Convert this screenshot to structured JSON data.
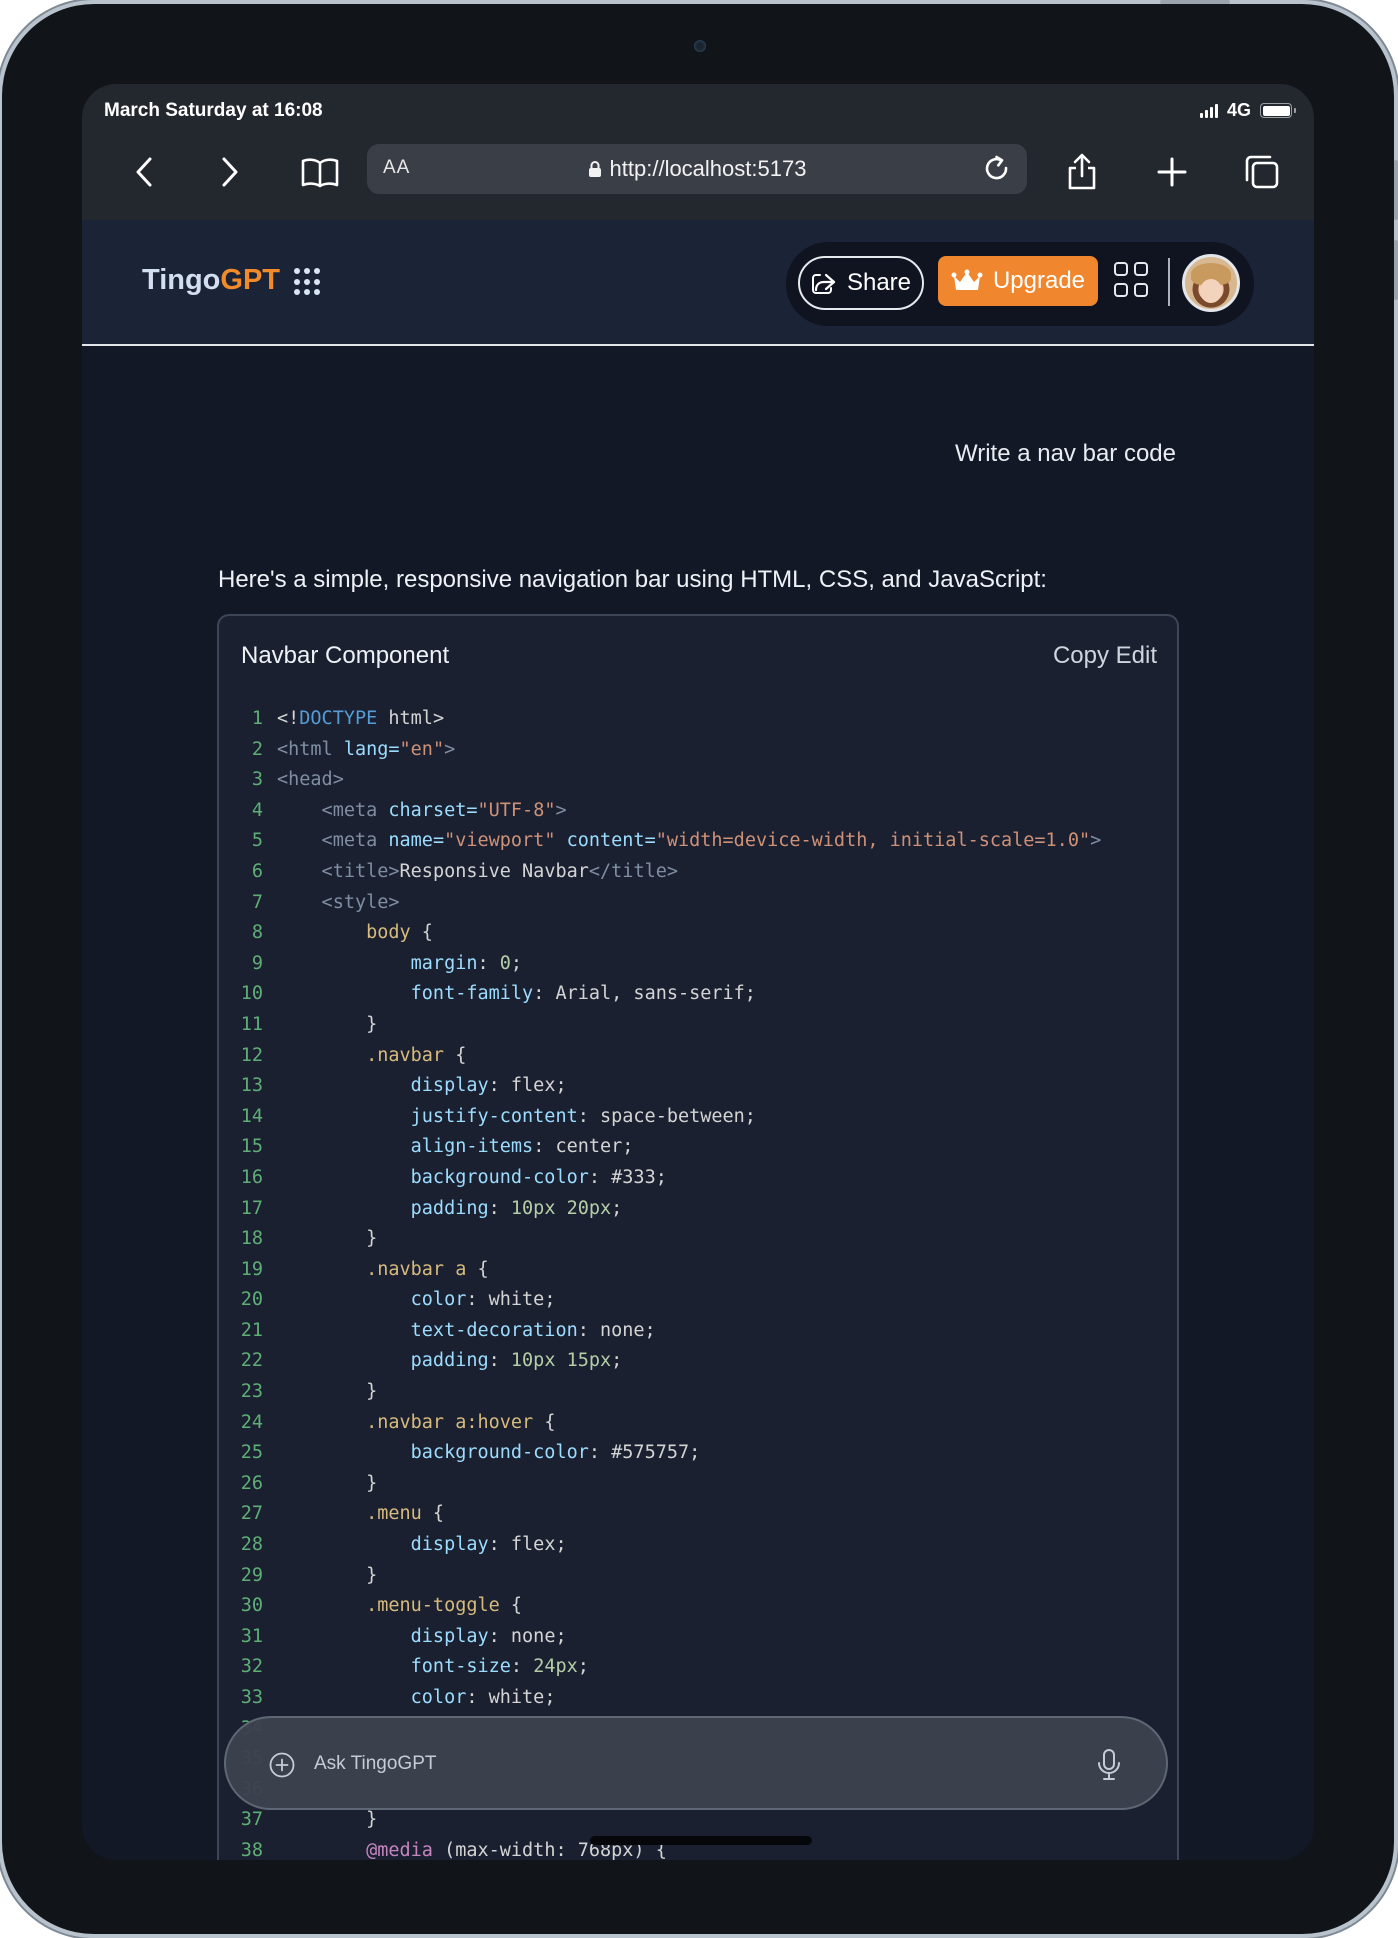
{
  "status_bar": {
    "time": "March Saturday at 16:08",
    "network": "4G"
  },
  "browser": {
    "url": "http://localhost:5173",
    "text_size_label": "AA"
  },
  "header": {
    "logo_part1": "Tingo",
    "logo_part2": "GPT",
    "share_label": "Share",
    "upgrade_label": "Upgrade",
    "colors": {
      "accent": "#f0862d",
      "header_bg": "#1b2336",
      "page_bg": "#121826"
    }
  },
  "chat": {
    "user_message": "Write a nav bar code",
    "assistant_intro": "Here's a simple, responsive navigation bar using HTML, CSS, and JavaScript:",
    "code_card": {
      "title": "Navbar Component",
      "actions": "Copy Edit",
      "lines": [
        [
          {
            "t": "<!",
            "c": "#d4d4d4"
          },
          {
            "t": "DOCTYPE",
            "c": "#569cd6"
          },
          {
            "t": " html>",
            "c": "#d4d4d4"
          }
        ],
        [
          {
            "t": "<html",
            "c": "#7f8ea3"
          },
          {
            "t": " lang=",
            "c": "#9cdcfe"
          },
          {
            "t": "\"en\"",
            "c": "#ce9178"
          },
          {
            "t": ">",
            "c": "#7f8ea3"
          }
        ],
        [
          {
            "t": "<head>",
            "c": "#7f8ea3"
          }
        ],
        [
          {
            "t": "    <meta",
            "c": "#7f8ea3"
          },
          {
            "t": " charset=",
            "c": "#9cdcfe"
          },
          {
            "t": "\"UTF-8\"",
            "c": "#ce9178"
          },
          {
            "t": ">",
            "c": "#7f8ea3"
          }
        ],
        [
          {
            "t": "    <meta",
            "c": "#7f8ea3"
          },
          {
            "t": " name=",
            "c": "#9cdcfe"
          },
          {
            "t": "\"viewport\"",
            "c": "#ce9178"
          },
          {
            "t": " content=",
            "c": "#9cdcfe"
          },
          {
            "t": "\"width=device-width, initial-scale=1.0\"",
            "c": "#ce9178"
          },
          {
            "t": ">",
            "c": "#7f8ea3"
          }
        ],
        [
          {
            "t": "    <title>",
            "c": "#7f8ea3"
          },
          {
            "t": "Responsive Navbar",
            "c": "#d4d4d4"
          },
          {
            "t": "</title>",
            "c": "#7f8ea3"
          }
        ],
        [
          {
            "t": "    <style>",
            "c": "#7f8ea3"
          }
        ],
        [
          {
            "t": "        body",
            "c": "#d7ba7d"
          },
          {
            "t": " {",
            "c": "#d4d4d4"
          }
        ],
        [
          {
            "t": "            margin",
            "c": "#9cdcfe"
          },
          {
            "t": ": ",
            "c": "#d4d4d4"
          },
          {
            "t": "0",
            "c": "#b5cea8"
          },
          {
            "t": ";",
            "c": "#d4d4d4"
          }
        ],
        [
          {
            "t": "            font-family",
            "c": "#9cdcfe"
          },
          {
            "t": ": Arial, sans-serif;",
            "c": "#d4d4d4"
          }
        ],
        [
          {
            "t": "        }",
            "c": "#d4d4d4"
          }
        ],
        [
          {
            "t": "        .navbar",
            "c": "#d7ba7d"
          },
          {
            "t": " {",
            "c": "#d4d4d4"
          }
        ],
        [
          {
            "t": "            display",
            "c": "#9cdcfe"
          },
          {
            "t": ": flex;",
            "c": "#d4d4d4"
          }
        ],
        [
          {
            "t": "            justify-content",
            "c": "#9cdcfe"
          },
          {
            "t": ": space-between;",
            "c": "#d4d4d4"
          }
        ],
        [
          {
            "t": "            align-items",
            "c": "#9cdcfe"
          },
          {
            "t": ": center;",
            "c": "#d4d4d4"
          }
        ],
        [
          {
            "t": "            background-color",
            "c": "#9cdcfe"
          },
          {
            "t": ": #333;",
            "c": "#d4d4d4"
          }
        ],
        [
          {
            "t": "            padding",
            "c": "#9cdcfe"
          },
          {
            "t": ": ",
            "c": "#d4d4d4"
          },
          {
            "t": "10px 20px",
            "c": "#b5cea8"
          },
          {
            "t": ";",
            "c": "#d4d4d4"
          }
        ],
        [
          {
            "t": "        }",
            "c": "#d4d4d4"
          }
        ],
        [
          {
            "t": "        .navbar a",
            "c": "#d7ba7d"
          },
          {
            "t": " {",
            "c": "#d4d4d4"
          }
        ],
        [
          {
            "t": "            color",
            "c": "#9cdcfe"
          },
          {
            "t": ": white;",
            "c": "#d4d4d4"
          }
        ],
        [
          {
            "t": "            text-decoration",
            "c": "#9cdcfe"
          },
          {
            "t": ": none;",
            "c": "#d4d4d4"
          }
        ],
        [
          {
            "t": "            padding",
            "c": "#9cdcfe"
          },
          {
            "t": ": ",
            "c": "#d4d4d4"
          },
          {
            "t": "10px 15px",
            "c": "#b5cea8"
          },
          {
            "t": ";",
            "c": "#d4d4d4"
          }
        ],
        [
          {
            "t": "        }",
            "c": "#d4d4d4"
          }
        ],
        [
          {
            "t": "        .navbar a:hover",
            "c": "#d7ba7d"
          },
          {
            "t": " {",
            "c": "#d4d4d4"
          }
        ],
        [
          {
            "t": "            background-color",
            "c": "#9cdcfe"
          },
          {
            "t": ": #575757;",
            "c": "#d4d4d4"
          }
        ],
        [
          {
            "t": "        }",
            "c": "#d4d4d4"
          }
        ],
        [
          {
            "t": "        .menu",
            "c": "#d7ba7d"
          },
          {
            "t": " {",
            "c": "#d4d4d4"
          }
        ],
        [
          {
            "t": "            display",
            "c": "#9cdcfe"
          },
          {
            "t": ": flex;",
            "c": "#d4d4d4"
          }
        ],
        [
          {
            "t": "        }",
            "c": "#d4d4d4"
          }
        ],
        [
          {
            "t": "        .menu-toggle",
            "c": "#d7ba7d"
          },
          {
            "t": " {",
            "c": "#d4d4d4"
          }
        ],
        [
          {
            "t": "            display",
            "c": "#9cdcfe"
          },
          {
            "t": ": none;",
            "c": "#d4d4d4"
          }
        ],
        [
          {
            "t": "            font-size",
            "c": "#9cdcfe"
          },
          {
            "t": ": ",
            "c": "#d4d4d4"
          },
          {
            "t": "24px",
            "c": "#b5cea8"
          },
          {
            "t": ";",
            "c": "#d4d4d4"
          }
        ],
        [
          {
            "t": "            color",
            "c": "#9cdcfe"
          },
          {
            "t": ": white;",
            "c": "#d4d4d4"
          }
        ],
        [
          {
            "t": "",
            "c": "#d4d4d4"
          }
        ],
        [
          {
            "t": "",
            "c": "#d4d4d4"
          }
        ],
        [
          {
            "t": "",
            "c": "#d4d4d4"
          }
        ],
        [
          {
            "t": "        }",
            "c": "#d4d4d4"
          }
        ],
        [
          {
            "t": "        @media",
            "c": "#c586c0"
          },
          {
            "t": " (max-width: 768px) {",
            "c": "#d4d4d4"
          }
        ]
      ]
    }
  },
  "input": {
    "placeholder": "Ask TingoGPT"
  }
}
